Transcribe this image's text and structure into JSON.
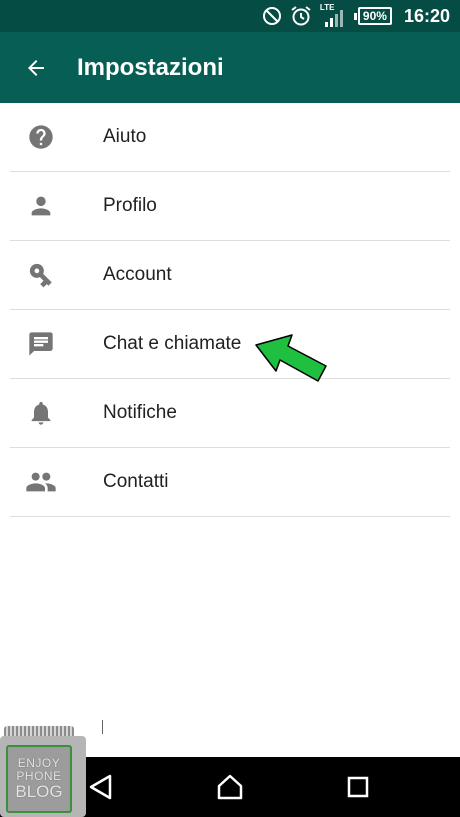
{
  "status_bar": {
    "network": "LTE",
    "battery": "90%",
    "time": "16:20"
  },
  "app_bar": {
    "title": "Impostazioni"
  },
  "settings": {
    "items": [
      {
        "label": "Aiuto",
        "icon": "help-icon"
      },
      {
        "label": "Profilo",
        "icon": "person-icon"
      },
      {
        "label": "Account",
        "icon": "key-icon"
      },
      {
        "label": "Chat e chiamate",
        "icon": "chat-icon"
      },
      {
        "label": "Notifiche",
        "icon": "bell-icon"
      },
      {
        "label": "Contatti",
        "icon": "group-icon"
      }
    ]
  },
  "watermark": {
    "line1": "ENJOY",
    "line2": "PHONE",
    "line3": "BLOG"
  },
  "colors": {
    "status_bar": "#054d44",
    "app_bar": "#075e54",
    "icon_gray": "#757575",
    "arrow_green": "#1fbf3f"
  }
}
